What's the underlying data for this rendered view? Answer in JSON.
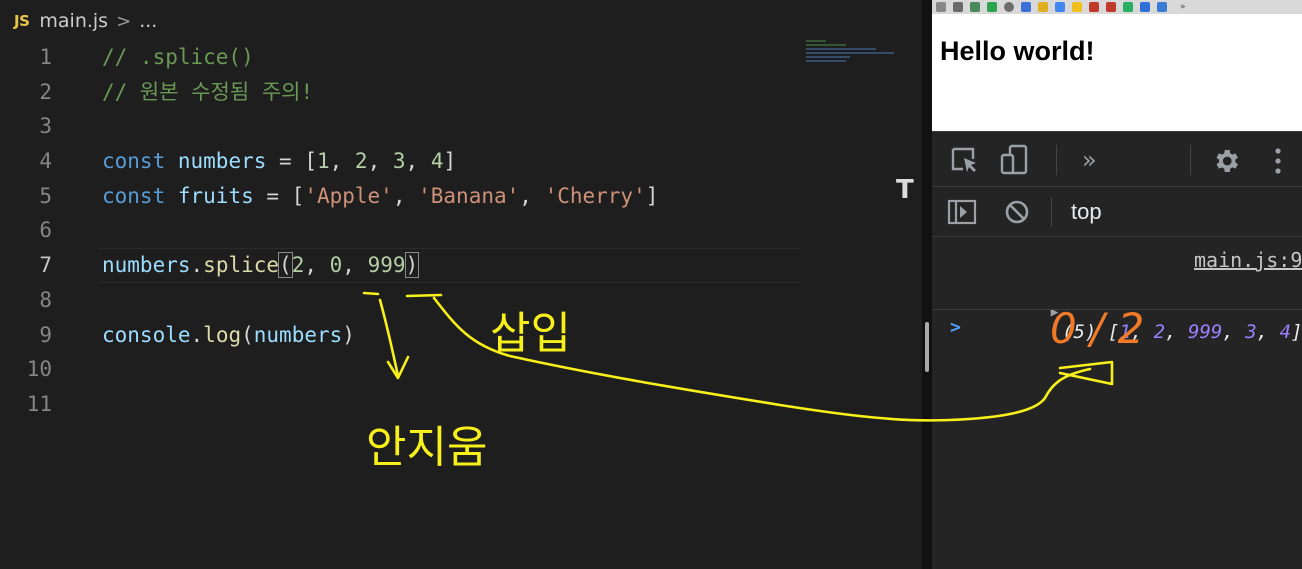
{
  "editor": {
    "breadcrumb": {
      "badge": "JS",
      "file": "main.js",
      "separator": ">",
      "more": "..."
    },
    "lines": [
      {
        "n": "1",
        "tokens": [
          {
            "t": "// .splice()",
            "c": "comment"
          }
        ]
      },
      {
        "n": "2",
        "tokens": [
          {
            "t": "// 원본 수정됨 주의!",
            "c": "comment"
          }
        ]
      },
      {
        "n": "3",
        "tokens": []
      },
      {
        "n": "4",
        "tokens": [
          {
            "t": "const",
            "c": "kw"
          },
          {
            "t": " ",
            "c": "pun"
          },
          {
            "t": "numbers",
            "c": "var"
          },
          {
            "t": " = [",
            "c": "pun"
          },
          {
            "t": "1",
            "c": "num"
          },
          {
            "t": ", ",
            "c": "pun"
          },
          {
            "t": "2",
            "c": "num"
          },
          {
            "t": ", ",
            "c": "pun"
          },
          {
            "t": "3",
            "c": "num"
          },
          {
            "t": ", ",
            "c": "pun"
          },
          {
            "t": "4",
            "c": "num"
          },
          {
            "t": "]",
            "c": "pun"
          }
        ]
      },
      {
        "n": "5",
        "tokens": [
          {
            "t": "const",
            "c": "kw"
          },
          {
            "t": " ",
            "c": "pun"
          },
          {
            "t": "fruits",
            "c": "var"
          },
          {
            "t": " = [",
            "c": "pun"
          },
          {
            "t": "'Apple'",
            "c": "str"
          },
          {
            "t": ", ",
            "c": "pun"
          },
          {
            "t": "'Banana'",
            "c": "str"
          },
          {
            "t": ", ",
            "c": "pun"
          },
          {
            "t": "'Cherry'",
            "c": "str"
          },
          {
            "t": "]",
            "c": "pun"
          }
        ]
      },
      {
        "n": "6",
        "tokens": []
      },
      {
        "n": "7",
        "current": true,
        "tokens": [
          {
            "t": "numbers",
            "c": "var"
          },
          {
            "t": ".",
            "c": "pun"
          },
          {
            "t": "splice",
            "c": "fn"
          },
          {
            "t": "(",
            "c": "pun",
            "b": true
          },
          {
            "t": "2",
            "c": "num"
          },
          {
            "t": ", ",
            "c": "pun"
          },
          {
            "t": "0",
            "c": "num"
          },
          {
            "t": ", ",
            "c": "pun"
          },
          {
            "t": "999",
            "c": "num"
          },
          {
            "t": ")",
            "c": "pun",
            "b": true
          }
        ]
      },
      {
        "n": "8",
        "tokens": []
      },
      {
        "n": "9",
        "tokens": [
          {
            "t": "console",
            "c": "var"
          },
          {
            "t": ".",
            "c": "pun"
          },
          {
            "t": "log",
            "c": "fn"
          },
          {
            "t": "(",
            "c": "pun"
          },
          {
            "t": "numbers",
            "c": "var"
          },
          {
            "t": ")",
            "c": "pun"
          }
        ]
      },
      {
        "n": "10",
        "tokens": []
      },
      {
        "n": "11",
        "tokens": []
      }
    ]
  },
  "browser": {
    "page_heading": "Hello world!",
    "devtools": {
      "more_tabs": "»",
      "context": "top",
      "console": {
        "source_link": "main.js:9",
        "log_arrow": "▶",
        "log_count": "(5)",
        "array_values": [
          "1",
          "2",
          "999",
          "3",
          "4"
        ],
        "prompt": ">"
      }
    }
  },
  "annotations": {
    "left_note": "안지움",
    "right_note": "삽입",
    "console_note": "0 / 2"
  },
  "colors": {
    "editor_bg": "#1e1e1e",
    "annotation": "#f7f01a",
    "console_note": "#f07a28"
  }
}
